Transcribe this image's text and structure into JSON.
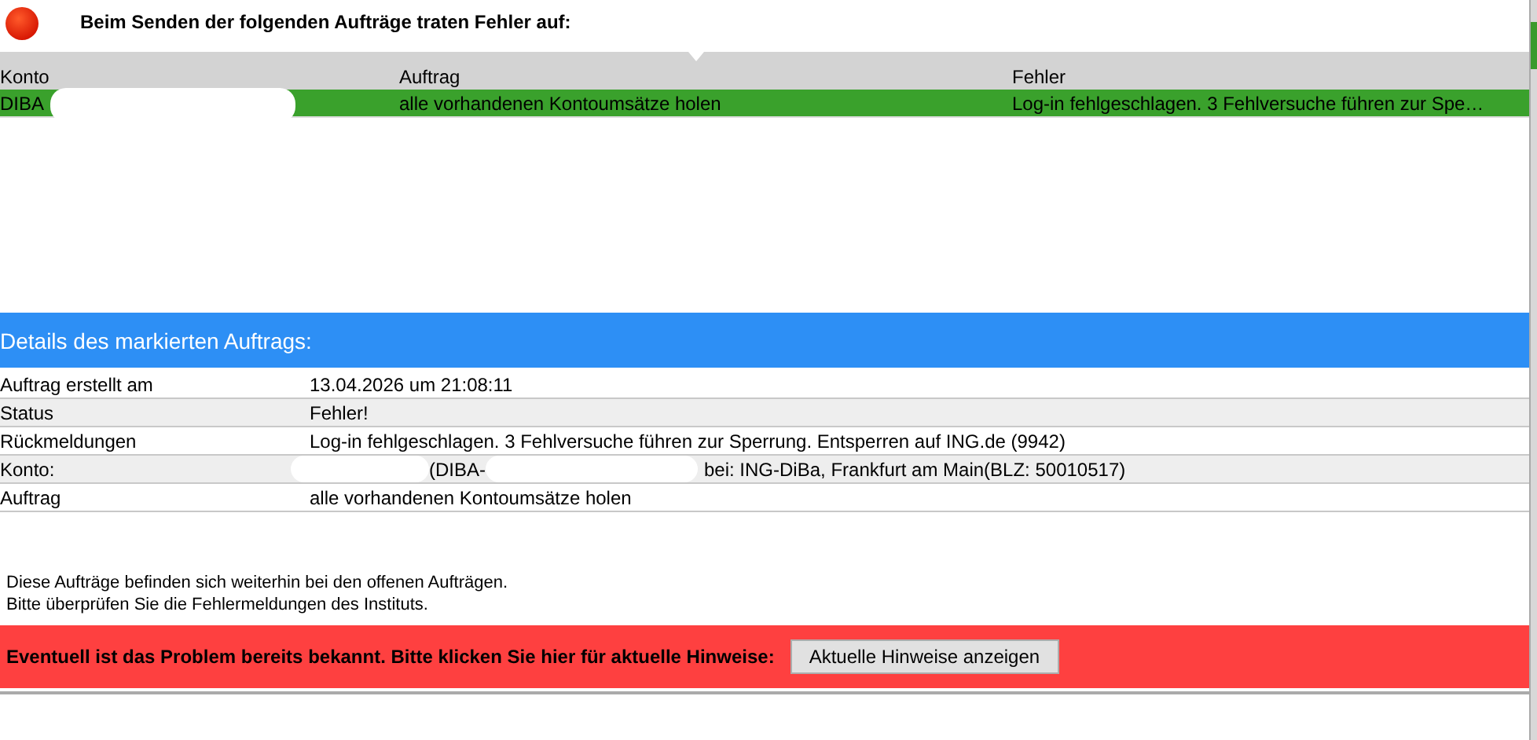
{
  "header": {
    "title": "Beim Senden der folgenden Aufträge traten Fehler auf:"
  },
  "table": {
    "columns": [
      "Konto",
      "Auftrag",
      "Fehler"
    ],
    "rows": [
      {
        "cells": [
          "DIBA",
          "alle vorhandenen Kontoumsätze holen",
          "Log-in fehlgeschlagen. 3 Fehlversuche führen zur Spe…"
        ],
        "selected": true
      }
    ]
  },
  "details": {
    "title": "Details des markierten Auftrags:",
    "rows": [
      {
        "label": "Auftrag erstellt am",
        "value": "13.04.2026 um 21:08:11"
      },
      {
        "label": "Status",
        "value": "Fehler!"
      },
      {
        "label": "Rückmeldungen",
        "value": "Log-in fehlgeschlagen. 3 Fehlversuche führen zur Sperrung. Entsperren auf ING.de (9942)"
      },
      {
        "label": "Konto:",
        "value": "(DIBA-",
        "value_2": "bei: ING-DiBa, Frankfurt am Main(BLZ: 50010517)"
      },
      {
        "label": "Auftrag",
        "value": "alle vorhandenen Kontoumsätze holen"
      }
    ]
  },
  "notes": [
    "Diese Aufträge befinden sich weiterhin bei den offenen Aufträgen.",
    "Bitte überprüfen Sie die Fehlermeldungen des Instituts."
  ],
  "banner": {
    "text": "Eventuell ist das Problem bereits bekannt. Bitte klicken Sie hier für aktuelle Hinweise:",
    "button": "Aktuelle Hinweise anzeigen"
  }
}
